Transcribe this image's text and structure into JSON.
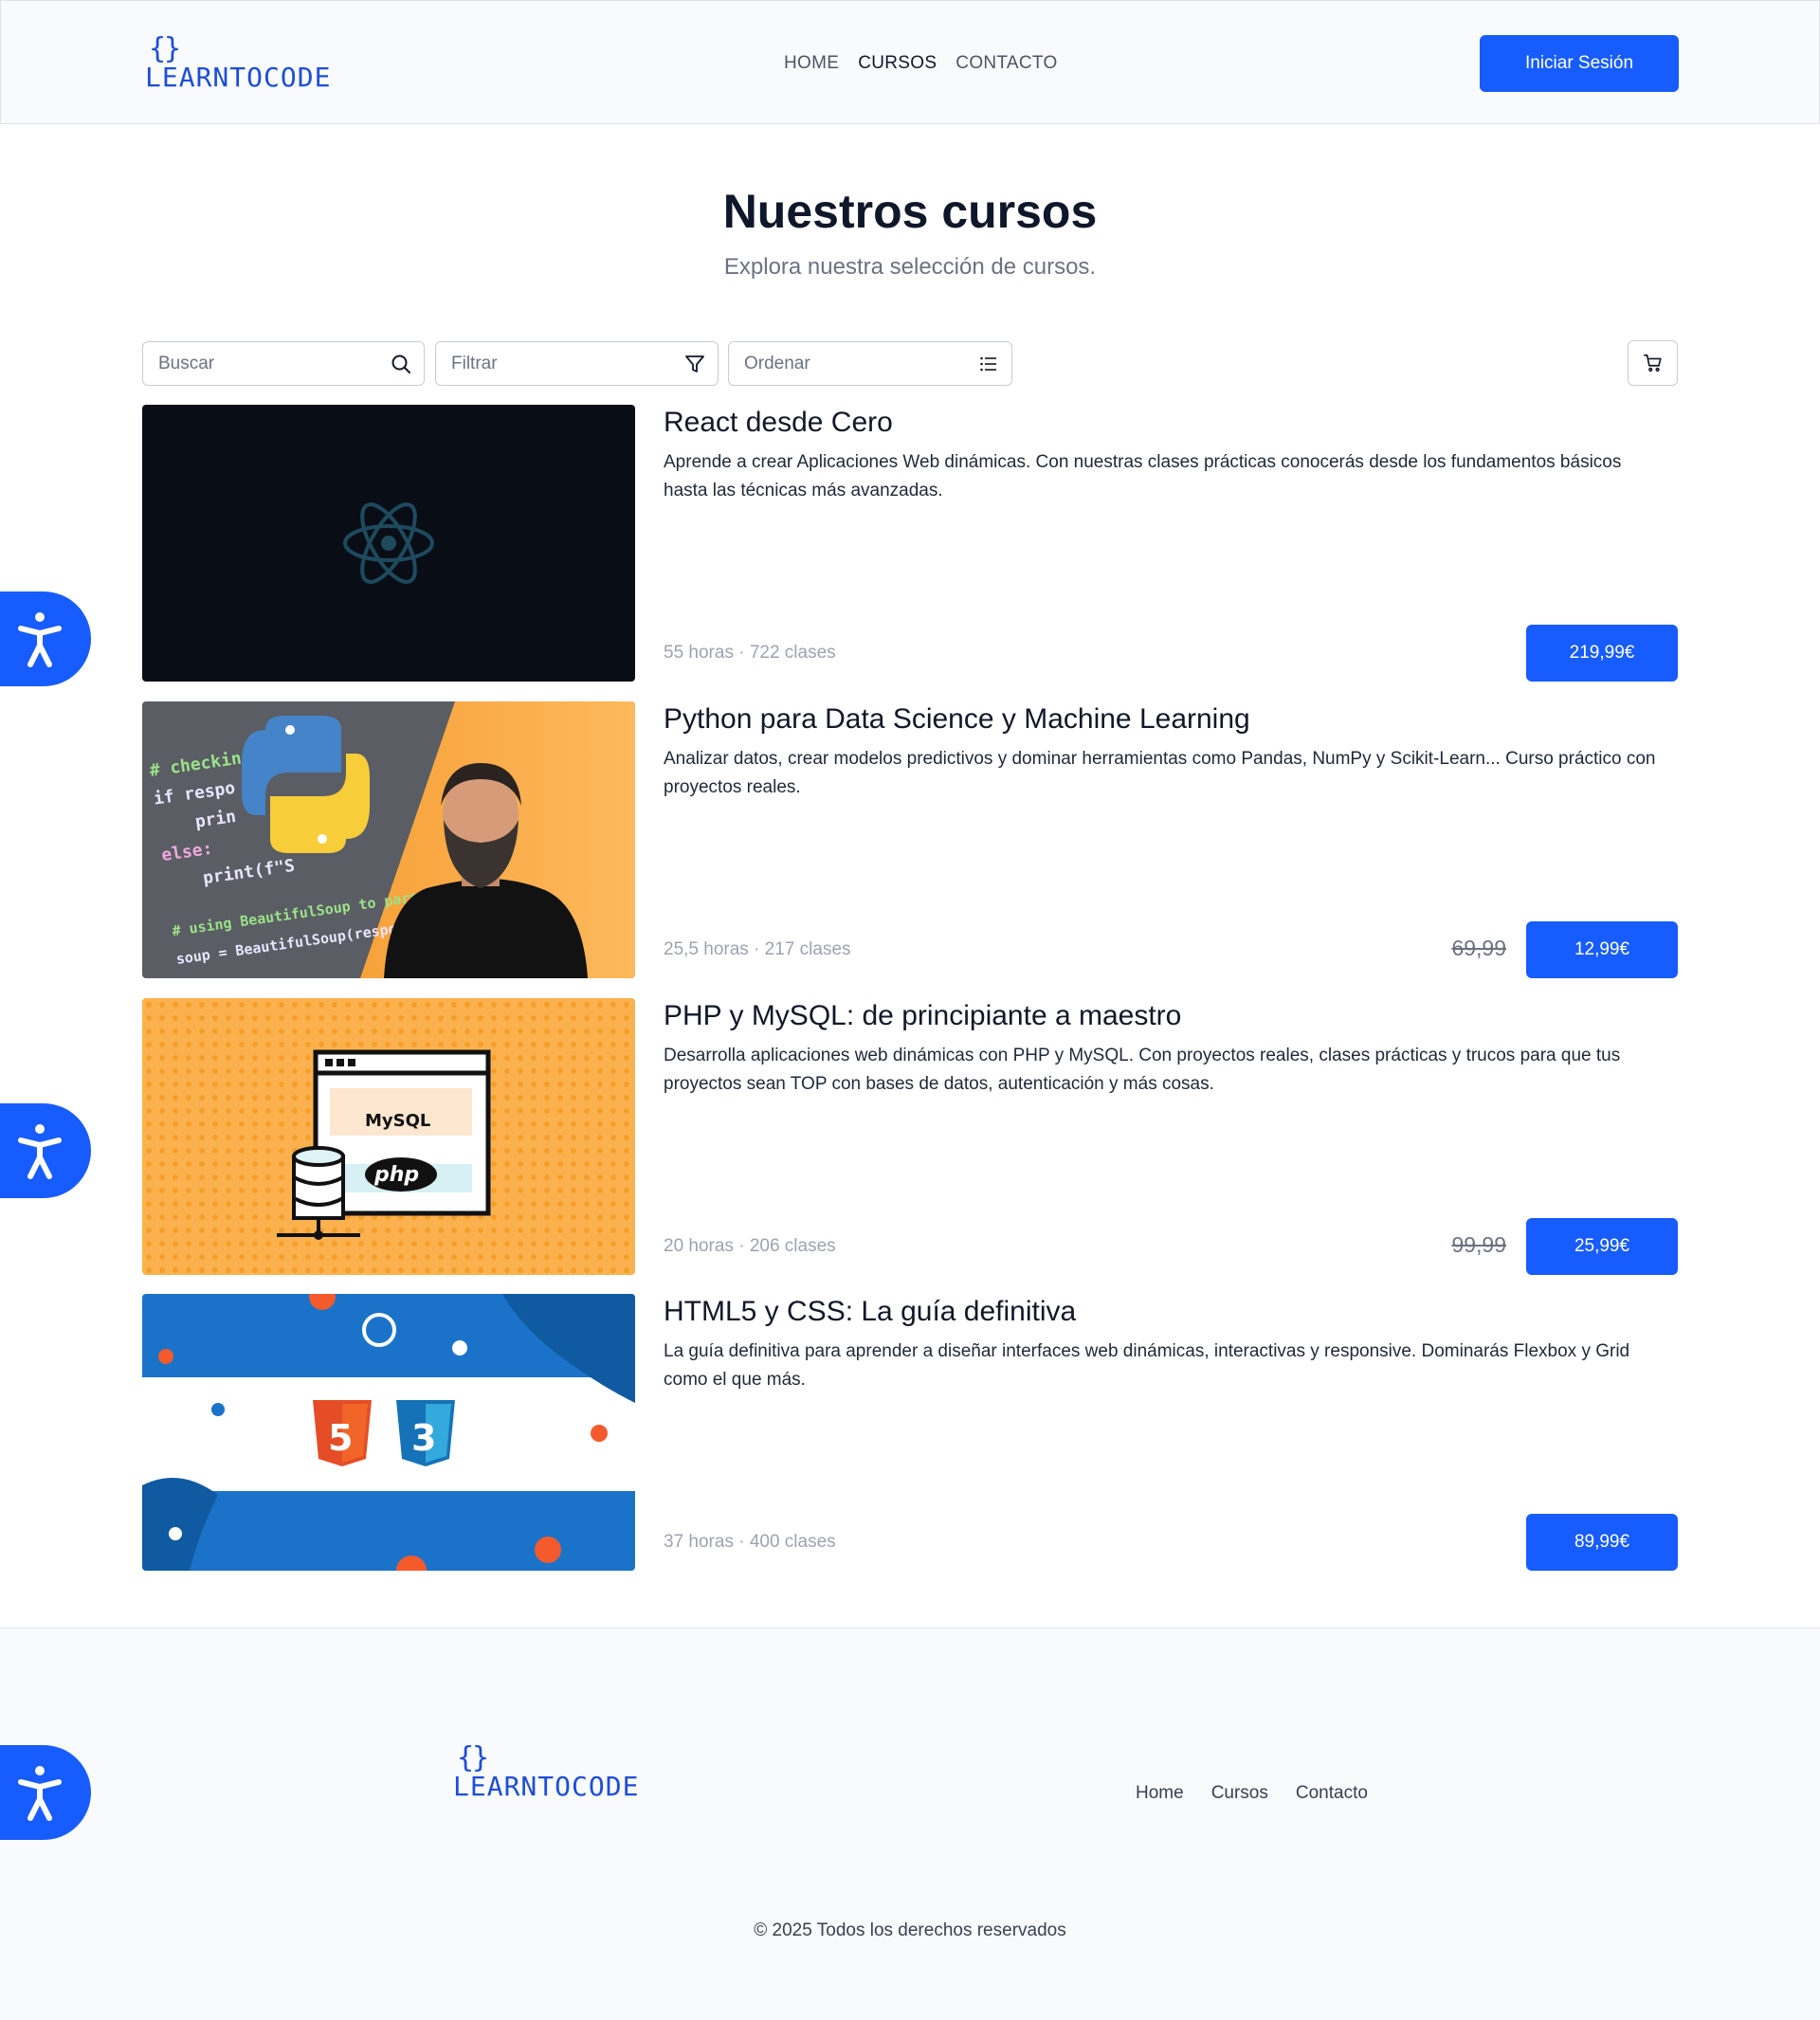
{
  "header": {
    "logo_braces": "{}",
    "logo_text": "LEARNTOCODE",
    "nav": [
      "HOME",
      "CURSOS",
      "CONTACTO"
    ],
    "login_label": "Iniciar Sesión"
  },
  "hero": {
    "title": "Nuestros cursos",
    "subtitle": "Explora nuestra selección de cursos."
  },
  "toolbar": {
    "search_placeholder": "Buscar",
    "filter_placeholder": "Filtrar",
    "sort_placeholder": "Ordenar",
    "icons": [
      "search-icon",
      "filter-icon",
      "list-icon",
      "cart-icon"
    ]
  },
  "courses": [
    {
      "title": "React desde Cero",
      "description": "Aprende a crear Aplicaciones Web dinámicas. Con nuestras clases prácticas conocerás desde los fundamentos básicos hasta las técnicas más avanzadas.",
      "meta": "55 horas · 722 clases",
      "old_price": "",
      "price": "219,99€"
    },
    {
      "title": "Python para Data Science y Machine Learning",
      "description": "Analizar datos, crear modelos predictivos y dominar herramientas como Pandas, NumPy y Scikit-Learn... Curso práctico con proyectos reales.",
      "meta": "25,5 horas · 217 clases",
      "old_price": "69,99",
      "price": "12,99€"
    },
    {
      "title": "PHP y MySQL: de principiante a maestro",
      "description": "Desarrolla aplicaciones web dinámicas con PHP y MySQL. Con proyectos reales, clases prácticas y trucos para que tus proyectos sean TOP con bases de datos, autenticación y más cosas.",
      "meta": "20 horas · 206 clases",
      "old_price": "99,99",
      "price": "25,99€"
    },
    {
      "title": "HTML5 y CSS: La guía definitiva",
      "description": "La guía definitiva para aprender a diseñar interfaces web dinámicas, interactivas y responsive. Dominarás Flexbox y Grid como el que más.",
      "meta": "37 horas · 400 clases",
      "old_price": "",
      "price": "89,99€"
    }
  ],
  "thumb_text": {
    "python_code": [
      "# checking r",
      "if respo",
      "prin",
      "else:",
      "print(f\"S",
      "# using BeautifulSoup to parse the",
      "soup = BeautifulSoup(response.conte"
    ],
    "mysql": "MySQL",
    "php": "php",
    "html5": "5",
    "css3": "3"
  },
  "footer": {
    "logo_braces": "{}",
    "logo_text": "LEARNTOCODE",
    "nav": [
      "Home",
      "Cursos",
      "Contacto"
    ],
    "copyright": "© 2025 Todos los derechos reservados"
  },
  "colors": {
    "primary": "#175cff",
    "logo": "#1d4ed8",
    "background_alt": "#f8fafc"
  },
  "accessibility_icon": "accessibility-icon"
}
